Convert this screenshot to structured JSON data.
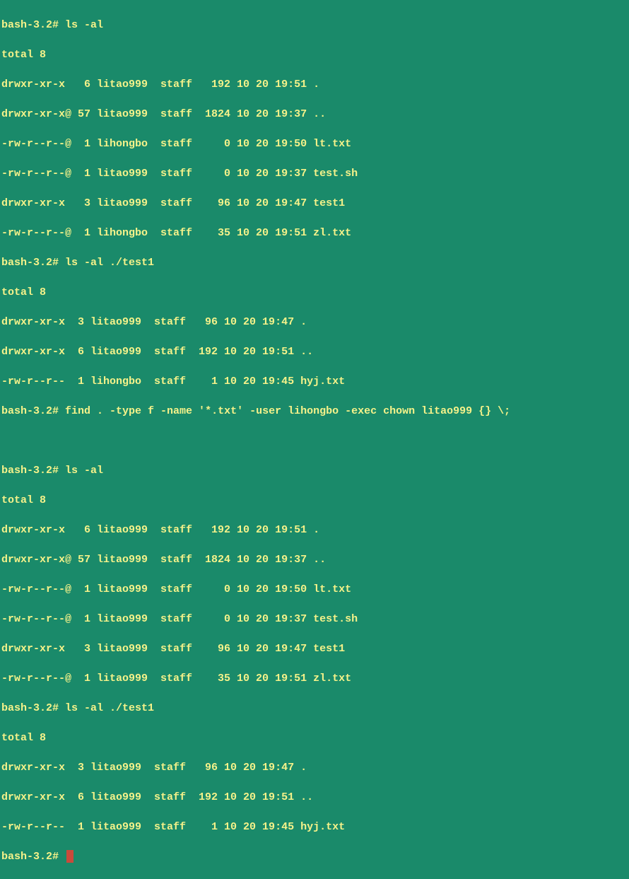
{
  "prompt": "bash-3.2#",
  "commands": {
    "ls1": "ls -al",
    "ls2": "ls -al ./test1",
    "find": "find . -type f -name '*.txt' -user lihongbo -exec chown litao999 {} \\;",
    "ls3": "ls -al",
    "ls4": "ls -al ./test1"
  },
  "total": "total 8",
  "listing1": [
    "drwxr-xr-x   6 litao999  staff   192 10 20 19:51 .",
    "drwxr-xr-x@ 57 litao999  staff  1824 10 20 19:37 ..",
    "-rw-r--r--@  1 lihongbo  staff     0 10 20 19:50 lt.txt",
    "-rw-r--r--@  1 litao999  staff     0 10 20 19:37 test.sh",
    "drwxr-xr-x   3 litao999  staff    96 10 20 19:47 test1",
    "-rw-r--r--@  1 lihongbo  staff    35 10 20 19:51 zl.txt"
  ],
  "listing2": [
    "drwxr-xr-x  3 litao999  staff   96 10 20 19:47 .",
    "drwxr-xr-x  6 litao999  staff  192 10 20 19:51 ..",
    "-rw-r--r--  1 lihongbo  staff    1 10 20 19:45 hyj.txt"
  ],
  "listing3": [
    "drwxr-xr-x   6 litao999  staff   192 10 20 19:51 .",
    "drwxr-xr-x@ 57 litao999  staff  1824 10 20 19:37 ..",
    "-rw-r--r--@  1 litao999  staff     0 10 20 19:50 lt.txt",
    "-rw-r--r--@  1 litao999  staff     0 10 20 19:37 test.sh",
    "drwxr-xr-x   3 litao999  staff    96 10 20 19:47 test1",
    "-rw-r--r--@  1 litao999  staff    35 10 20 19:51 zl.txt"
  ],
  "listing4": [
    "drwxr-xr-x  3 litao999  staff   96 10 20 19:47 .",
    "drwxr-xr-x  6 litao999  staff  192 10 20 19:51 ..",
    "-rw-r--r--  1 litao999  staff    1 10 20 19:45 hyj.txt"
  ]
}
